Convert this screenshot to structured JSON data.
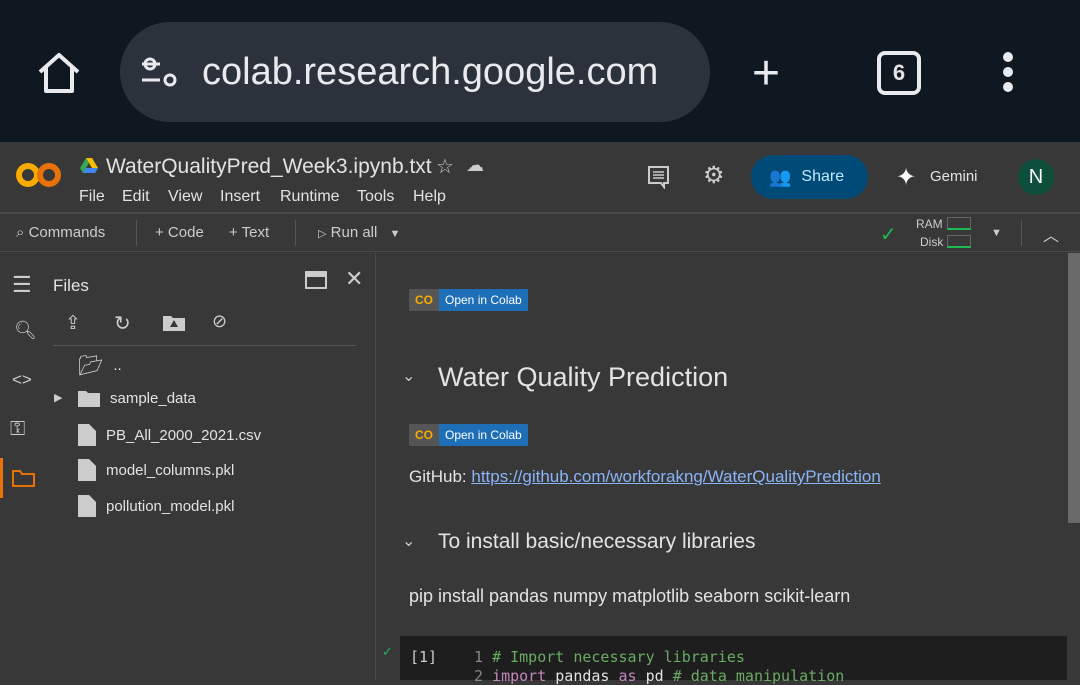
{
  "browser": {
    "url": "colab.research.google.com",
    "tab_count": "6"
  },
  "header": {
    "file_name": "WaterQualityPred_Week3.ipynb.txt",
    "menu": [
      "File",
      "Edit",
      "View",
      "Insert",
      "Runtime",
      "Tools",
      "Help"
    ],
    "share": "Share",
    "gemini": "Gemini",
    "avatar": "N"
  },
  "toolbar": {
    "commands": "Commands",
    "code": "+ Code",
    "text": "+ Text",
    "run_all": "Run all",
    "ram": "RAM",
    "disk": "Disk"
  },
  "files": {
    "title": "Files",
    "items": [
      "..",
      "sample_data",
      "PB_All_2000_2021.csv",
      "model_columns.pkl",
      "pollution_model.pkl"
    ]
  },
  "notebook": {
    "badge": "Open in Colab",
    "heading": "Water Quality Prediction",
    "github_label": "GitHub: ",
    "github_url": "https://github.com/workforakng/WaterQualityPrediction",
    "subheading": "To install basic/necessary libraries",
    "pip": "pip install pandas numpy matplotlib seaborn scikit-learn",
    "cell": {
      "exec": "[1]",
      "lines": [
        {
          "n": "1",
          "code": "# Import necessary libraries"
        },
        {
          "n": "2",
          "kw": "import",
          "mid": " pandas ",
          "kw2": "as",
          "end": " pd ",
          "cm": "# data manipulation"
        }
      ]
    }
  },
  "colors": {
    "accent": "#f9ab00",
    "share_bg": "#004a77",
    "link": "#8ab4f8",
    "comment": "#6aaa64",
    "keyword": "#c586c0"
  }
}
